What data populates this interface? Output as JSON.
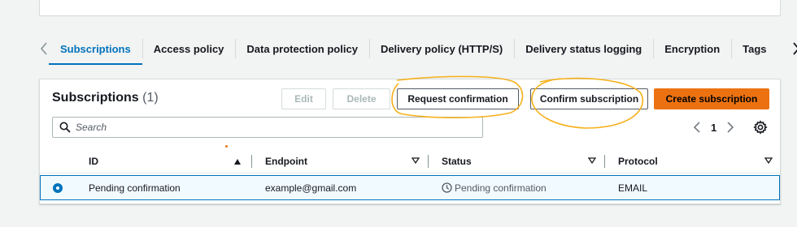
{
  "tabs": {
    "items": [
      {
        "label": "Subscriptions",
        "active": true
      },
      {
        "label": "Access policy",
        "active": false
      },
      {
        "label": "Data protection policy",
        "active": false
      },
      {
        "label": "Delivery policy (HTTP/S)",
        "active": false
      },
      {
        "label": "Delivery status logging",
        "active": false
      },
      {
        "label": "Encryption",
        "active": false
      },
      {
        "label": "Tags",
        "active": false
      }
    ]
  },
  "panel": {
    "title": "Subscriptions",
    "count": "(1)"
  },
  "actions": {
    "edit": "Edit",
    "delete": "Delete",
    "request_confirmation": "Request confirmation",
    "confirm_subscription": "Confirm subscription",
    "create_subscription": "Create subscription"
  },
  "search": {
    "placeholder": "Search",
    "value": ""
  },
  "pagination": {
    "current_page": "1"
  },
  "table": {
    "columns": [
      "ID",
      "Endpoint",
      "Status",
      "Protocol"
    ],
    "rows": [
      {
        "id": "Pending confirmation",
        "endpoint": "example@gmail.com",
        "status": "Pending confirmation",
        "protocol": "EMAIL",
        "selected": true
      }
    ]
  },
  "colors": {
    "accent": "#0073bb",
    "primary_button": "#ec7211",
    "annotation": "#f5b01a"
  }
}
